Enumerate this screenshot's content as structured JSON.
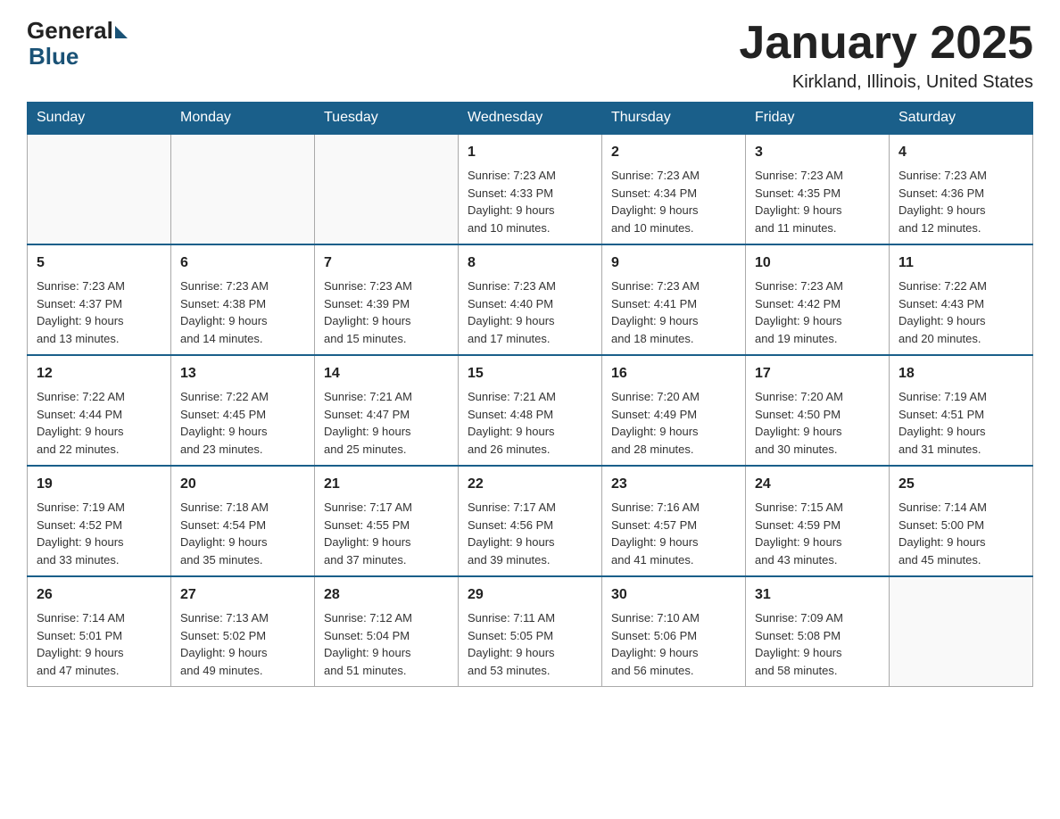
{
  "logo": {
    "general": "General",
    "blue": "Blue"
  },
  "header": {
    "title": "January 2025",
    "subtitle": "Kirkland, Illinois, United States"
  },
  "days_of_week": [
    "Sunday",
    "Monday",
    "Tuesday",
    "Wednesday",
    "Thursday",
    "Friday",
    "Saturday"
  ],
  "weeks": [
    [
      {
        "day": "",
        "info": ""
      },
      {
        "day": "",
        "info": ""
      },
      {
        "day": "",
        "info": ""
      },
      {
        "day": "1",
        "info": "Sunrise: 7:23 AM\nSunset: 4:33 PM\nDaylight: 9 hours\nand 10 minutes."
      },
      {
        "day": "2",
        "info": "Sunrise: 7:23 AM\nSunset: 4:34 PM\nDaylight: 9 hours\nand 10 minutes."
      },
      {
        "day": "3",
        "info": "Sunrise: 7:23 AM\nSunset: 4:35 PM\nDaylight: 9 hours\nand 11 minutes."
      },
      {
        "day": "4",
        "info": "Sunrise: 7:23 AM\nSunset: 4:36 PM\nDaylight: 9 hours\nand 12 minutes."
      }
    ],
    [
      {
        "day": "5",
        "info": "Sunrise: 7:23 AM\nSunset: 4:37 PM\nDaylight: 9 hours\nand 13 minutes."
      },
      {
        "day": "6",
        "info": "Sunrise: 7:23 AM\nSunset: 4:38 PM\nDaylight: 9 hours\nand 14 minutes."
      },
      {
        "day": "7",
        "info": "Sunrise: 7:23 AM\nSunset: 4:39 PM\nDaylight: 9 hours\nand 15 minutes."
      },
      {
        "day": "8",
        "info": "Sunrise: 7:23 AM\nSunset: 4:40 PM\nDaylight: 9 hours\nand 17 minutes."
      },
      {
        "day": "9",
        "info": "Sunrise: 7:23 AM\nSunset: 4:41 PM\nDaylight: 9 hours\nand 18 minutes."
      },
      {
        "day": "10",
        "info": "Sunrise: 7:23 AM\nSunset: 4:42 PM\nDaylight: 9 hours\nand 19 minutes."
      },
      {
        "day": "11",
        "info": "Sunrise: 7:22 AM\nSunset: 4:43 PM\nDaylight: 9 hours\nand 20 minutes."
      }
    ],
    [
      {
        "day": "12",
        "info": "Sunrise: 7:22 AM\nSunset: 4:44 PM\nDaylight: 9 hours\nand 22 minutes."
      },
      {
        "day": "13",
        "info": "Sunrise: 7:22 AM\nSunset: 4:45 PM\nDaylight: 9 hours\nand 23 minutes."
      },
      {
        "day": "14",
        "info": "Sunrise: 7:21 AM\nSunset: 4:47 PM\nDaylight: 9 hours\nand 25 minutes."
      },
      {
        "day": "15",
        "info": "Sunrise: 7:21 AM\nSunset: 4:48 PM\nDaylight: 9 hours\nand 26 minutes."
      },
      {
        "day": "16",
        "info": "Sunrise: 7:20 AM\nSunset: 4:49 PM\nDaylight: 9 hours\nand 28 minutes."
      },
      {
        "day": "17",
        "info": "Sunrise: 7:20 AM\nSunset: 4:50 PM\nDaylight: 9 hours\nand 30 minutes."
      },
      {
        "day": "18",
        "info": "Sunrise: 7:19 AM\nSunset: 4:51 PM\nDaylight: 9 hours\nand 31 minutes."
      }
    ],
    [
      {
        "day": "19",
        "info": "Sunrise: 7:19 AM\nSunset: 4:52 PM\nDaylight: 9 hours\nand 33 minutes."
      },
      {
        "day": "20",
        "info": "Sunrise: 7:18 AM\nSunset: 4:54 PM\nDaylight: 9 hours\nand 35 minutes."
      },
      {
        "day": "21",
        "info": "Sunrise: 7:17 AM\nSunset: 4:55 PM\nDaylight: 9 hours\nand 37 minutes."
      },
      {
        "day": "22",
        "info": "Sunrise: 7:17 AM\nSunset: 4:56 PM\nDaylight: 9 hours\nand 39 minutes."
      },
      {
        "day": "23",
        "info": "Sunrise: 7:16 AM\nSunset: 4:57 PM\nDaylight: 9 hours\nand 41 minutes."
      },
      {
        "day": "24",
        "info": "Sunrise: 7:15 AM\nSunset: 4:59 PM\nDaylight: 9 hours\nand 43 minutes."
      },
      {
        "day": "25",
        "info": "Sunrise: 7:14 AM\nSunset: 5:00 PM\nDaylight: 9 hours\nand 45 minutes."
      }
    ],
    [
      {
        "day": "26",
        "info": "Sunrise: 7:14 AM\nSunset: 5:01 PM\nDaylight: 9 hours\nand 47 minutes."
      },
      {
        "day": "27",
        "info": "Sunrise: 7:13 AM\nSunset: 5:02 PM\nDaylight: 9 hours\nand 49 minutes."
      },
      {
        "day": "28",
        "info": "Sunrise: 7:12 AM\nSunset: 5:04 PM\nDaylight: 9 hours\nand 51 minutes."
      },
      {
        "day": "29",
        "info": "Sunrise: 7:11 AM\nSunset: 5:05 PM\nDaylight: 9 hours\nand 53 minutes."
      },
      {
        "day": "30",
        "info": "Sunrise: 7:10 AM\nSunset: 5:06 PM\nDaylight: 9 hours\nand 56 minutes."
      },
      {
        "day": "31",
        "info": "Sunrise: 7:09 AM\nSunset: 5:08 PM\nDaylight: 9 hours\nand 58 minutes."
      },
      {
        "day": "",
        "info": ""
      }
    ]
  ]
}
